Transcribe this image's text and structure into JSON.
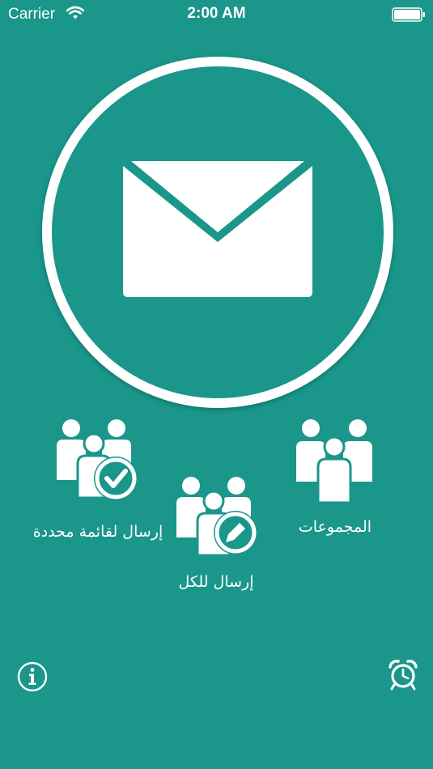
{
  "status_bar": {
    "carrier": "Carrier",
    "time": "2:00 AM"
  },
  "theme": {
    "background": "#1a968a",
    "foreground": "#ffffff"
  },
  "main": {
    "compose_icon": "envelope-icon"
  },
  "actions": {
    "send_selected": {
      "label": "إرسال لقائمة محددة",
      "icon": "group-check-icon"
    },
    "send_all": {
      "label": "إرسال للكل",
      "icon": "group-edit-icon"
    },
    "groups": {
      "label": "المجموعات",
      "icon": "group-icon"
    }
  },
  "footer": {
    "info_icon": "info-icon",
    "alarm_icon": "alarm-clock-icon"
  }
}
